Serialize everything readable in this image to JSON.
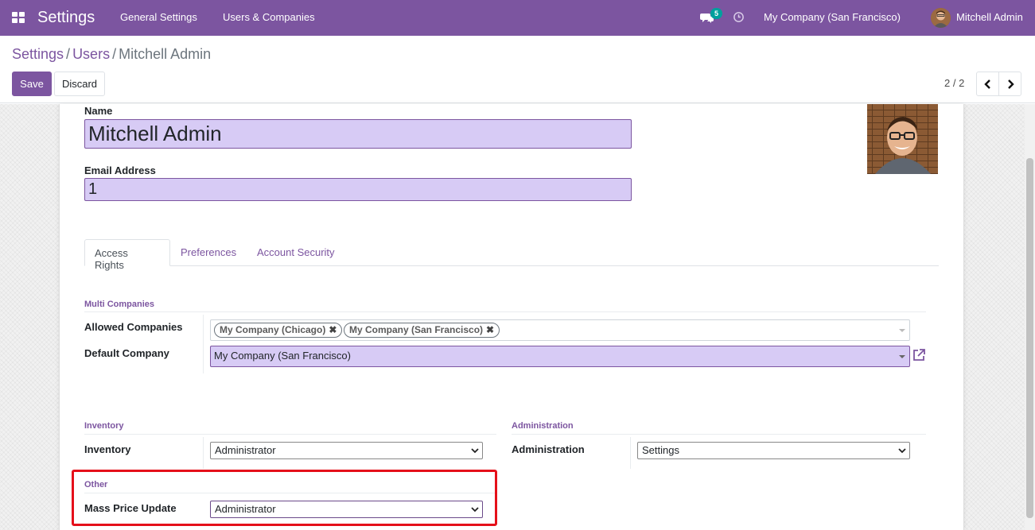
{
  "navbar": {
    "app_title": "Settings",
    "menu": [
      "General Settings",
      "Users & Companies"
    ],
    "chat_count": "5",
    "company": "My Company (San Francisco)",
    "user": "Mitchell Admin"
  },
  "breadcrumb": {
    "settings": "Settings",
    "sep1": "/",
    "users": "Users",
    "sep2": "/",
    "current": "Mitchell Admin"
  },
  "buttons": {
    "save": "Save",
    "discard": "Discard"
  },
  "pager": {
    "value": "2 / 2"
  },
  "form": {
    "name_label": "Name",
    "name_value": "Mitchell Admin",
    "email_label": "Email Address",
    "email_value": "1"
  },
  "tabs": [
    "Access Rights",
    "Preferences",
    "Account Security"
  ],
  "multi_companies": {
    "title": "Multi Companies",
    "allowed_label": "Allowed Companies",
    "allowed_tags": [
      "My Company (Chicago)",
      "My Company (San Francisco)"
    ],
    "default_label": "Default Company",
    "default_value": "My Company (San Francisco)"
  },
  "inventory": {
    "title": "Inventory",
    "label": "Inventory",
    "value": "Administrator"
  },
  "administration": {
    "title": "Administration",
    "label": "Administration",
    "value": "Settings"
  },
  "other": {
    "title": "Other",
    "label": "Mass Price Update",
    "value": "Administrator"
  },
  "colors": {
    "brand": "#7C55A0",
    "input_bg": "#D7CBF5",
    "badge": "#00A09D",
    "highlight": "#E5101A"
  },
  "icons": [
    "apps-icon",
    "chat-icon",
    "clock-icon",
    "chevron-left-icon",
    "chevron-right-icon",
    "external-link-icon",
    "tag-remove-icon",
    "chevron-down-icon"
  ]
}
